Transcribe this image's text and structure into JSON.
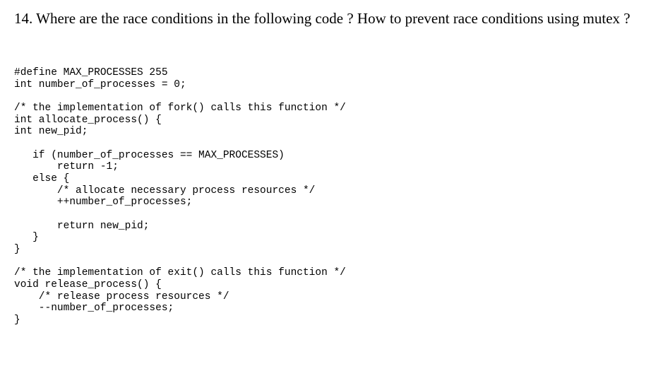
{
  "question": {
    "text": "14. Where are the race conditions in the following code ? How to prevent race conditions using mutex ?"
  },
  "code": {
    "line1": "#define MAX_PROCESSES 255",
    "line2": "int number_of_processes = 0;",
    "line3": "",
    "line4": "/* the implementation of fork() calls this function */",
    "line5": "int allocate_process() {",
    "line6": "int new_pid;",
    "line7": "",
    "line8": "   if (number_of_processes == MAX_PROCESSES)",
    "line9": "       return -1;",
    "line10": "   else {",
    "line11": "       /* allocate necessary process resources */",
    "line12": "       ++number_of_processes;",
    "line13": "",
    "line14": "       return new_pid;",
    "line15": "   }",
    "line16": "}",
    "line17": "",
    "line18": "/* the implementation of exit() calls this function */",
    "line19": "void release_process() {",
    "line20": "    /* release process resources */",
    "line21": "    --number_of_processes;",
    "line22": "}"
  }
}
